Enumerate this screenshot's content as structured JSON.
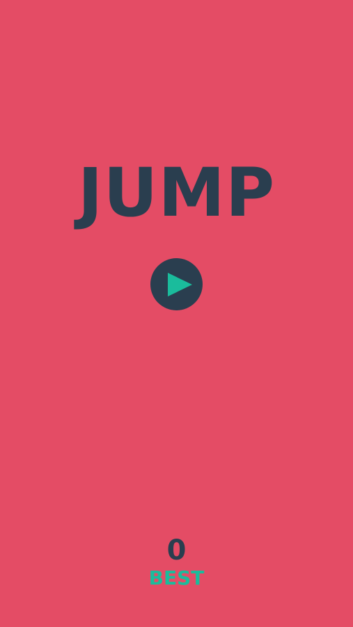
{
  "game": {
    "title": "JUMP",
    "best_score": "0",
    "best_label": "BEST"
  },
  "icons": {
    "play": "play-icon"
  },
  "colors": {
    "background": "#E44C65",
    "dark": "#2A3E4F",
    "accent": "#1ABC9C"
  }
}
